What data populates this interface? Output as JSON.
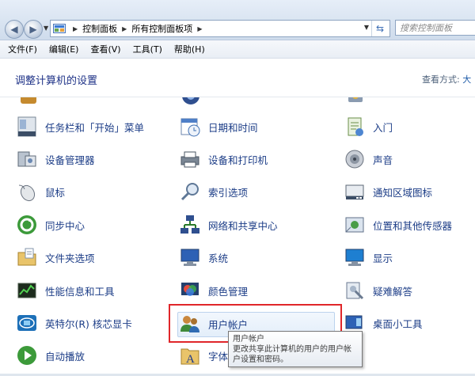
{
  "nav": {
    "breadcrumb": [
      "控制面板",
      "所有控制面板项"
    ],
    "search_placeholder": "搜索控制面板"
  },
  "menu": [
    "文件(F)",
    "编辑(E)",
    "查看(V)",
    "工具(T)",
    "帮助(H)"
  ],
  "header": {
    "title": "调整计算机的设置",
    "view_label": "查看方式:",
    "view_value": "大"
  },
  "items": {
    "taskbar": "任务栏和「开始」菜单",
    "datetime": "日期和时间",
    "getting_started": "入门",
    "device_manager": "设备管理器",
    "devices_printers": "设备和打印机",
    "sound": "声音",
    "mouse": "鼠标",
    "indexing": "索引选项",
    "notification_icons": "通知区域图标",
    "sync_center": "同步中心",
    "network_center": "网络和共享中心",
    "location_sensors": "位置和其他传感器",
    "folder_options": "文件夹选项",
    "system": "系统",
    "display": "显示",
    "performance": "性能信息和工具",
    "color_management": "颜色管理",
    "troubleshooting": "疑难解答",
    "intel_graphics": "英特尔(R) 核芯显卡",
    "user_accounts": "用户帐户",
    "gadgets": "桌面小工具",
    "autoplay": "自动播放",
    "fonts": "字体"
  },
  "tooltip": {
    "title": "用户帐户",
    "text": "更改共享此计算机的用户的用户帐户设置和密码。"
  }
}
